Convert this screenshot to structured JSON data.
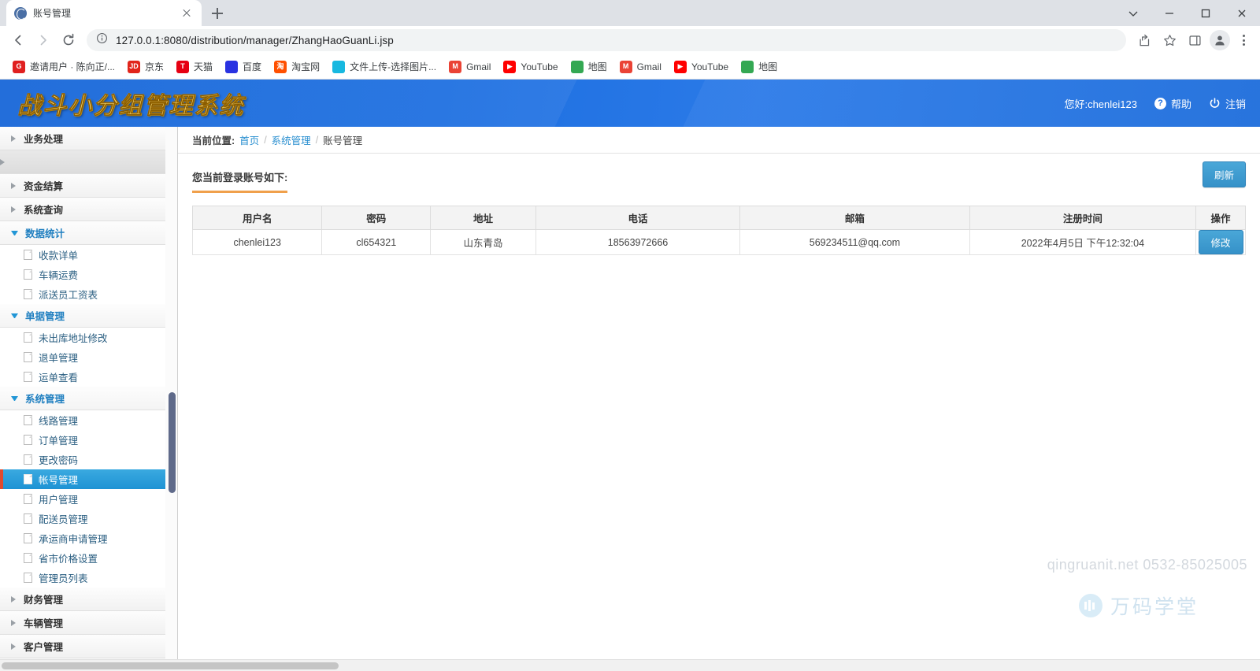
{
  "browser": {
    "tab": {
      "title": "账号管理",
      "favicon": "globe-icon"
    },
    "new_tab_label": "+",
    "url": "127.0.0.1:8080/distribution/manager/ZhangHaoGuanLi.jsp",
    "nav": {
      "back": "back-arrow",
      "forward": "forward-arrow",
      "reload": "reload-arrow"
    },
    "window_controls": {
      "minimize": "—",
      "maximize": "▢",
      "close": "✕",
      "tab_search": "⌄"
    },
    "bookmarks": [
      {
        "label": "邀请用户 · 陈向正/...",
        "icon_text": "G",
        "color": "#e02020"
      },
      {
        "label": "京东",
        "icon_text": "JD",
        "color": "#e1251b"
      },
      {
        "label": "天猫",
        "icon_text": "T",
        "color": "#e60012"
      },
      {
        "label": "百度",
        "icon_text": "",
        "color": "#2932e1"
      },
      {
        "label": "淘宝网",
        "icon_text": "淘",
        "color": "#ff5000"
      },
      {
        "label": "文件上传-选择图片...",
        "icon_text": "",
        "color": "#17b8e0"
      },
      {
        "label": "Gmail",
        "icon_text": "M",
        "color": "#ea4335"
      },
      {
        "label": "YouTube",
        "icon_text": "▶",
        "color": "#ff0000"
      },
      {
        "label": "地图",
        "icon_text": "",
        "color": "#34a853"
      },
      {
        "label": "Gmail",
        "icon_text": "M",
        "color": "#ea4335"
      },
      {
        "label": "YouTube",
        "icon_text": "▶",
        "color": "#ff0000"
      },
      {
        "label": "地图",
        "icon_text": "",
        "color": "#34a853"
      }
    ]
  },
  "app": {
    "logo_text": "战斗小分组管理系统",
    "greeting": "您好:chenlei123",
    "help_label": "帮助",
    "logout_label": "注销"
  },
  "breadcrumb": {
    "label": "当前位置:",
    "home": "首页",
    "parent": "系统管理",
    "current": "账号管理",
    "separator": "/"
  },
  "section": {
    "title": "您当前登录账号如下:",
    "refresh_label": "刷新"
  },
  "table": {
    "headers": [
      "用户名",
      "密码",
      "地址",
      "电话",
      "邮箱",
      "注册时间",
      "操作"
    ],
    "rows": [
      {
        "username": "chenlei123",
        "password": "cl654321",
        "address": "山东青岛",
        "phone": "18563972666",
        "email": "569234511@qq.com",
        "register_time": "2022年4月5日 下午12:32:04",
        "action_label": "修改"
      }
    ]
  },
  "sidebar": {
    "groups": [
      {
        "label": "业务处理",
        "open": false,
        "blank": false,
        "items": []
      },
      {
        "label": "",
        "open": false,
        "blank": true,
        "items": []
      },
      {
        "label": "资金结算",
        "open": false,
        "blank": false,
        "items": []
      },
      {
        "label": "系统查询",
        "open": false,
        "blank": false,
        "items": []
      },
      {
        "label": "数据统计",
        "open": true,
        "blank": false,
        "items": [
          {
            "label": "收款详单",
            "active": false
          },
          {
            "label": "车辆运费",
            "active": false
          },
          {
            "label": "派送员工资表",
            "active": false
          }
        ]
      },
      {
        "label": "单据管理",
        "open": true,
        "blank": false,
        "items": [
          {
            "label": "未出库地址修改",
            "active": false
          },
          {
            "label": "退单管理",
            "active": false
          },
          {
            "label": "运单查看",
            "active": false
          }
        ]
      },
      {
        "label": "系统管理",
        "open": true,
        "blank": false,
        "items": [
          {
            "label": "线路管理",
            "active": false
          },
          {
            "label": "订单管理",
            "active": false
          },
          {
            "label": "更改密码",
            "active": false
          },
          {
            "label": "帐号管理",
            "active": true
          },
          {
            "label": "用户管理",
            "active": false
          },
          {
            "label": "配送员管理",
            "active": false
          },
          {
            "label": "承运商申请管理",
            "active": false
          },
          {
            "label": "省市价格设置",
            "active": false
          },
          {
            "label": "管理员列表",
            "active": false
          }
        ]
      },
      {
        "label": "财务管理",
        "open": false,
        "blank": false,
        "items": []
      },
      {
        "label": "车辆管理",
        "open": false,
        "blank": false,
        "items": []
      },
      {
        "label": "客户管理",
        "open": false,
        "blank": false,
        "items": []
      }
    ]
  },
  "watermark": {
    "text": "qingruanit.net 0532-85025005",
    "brand": "万码学堂"
  }
}
